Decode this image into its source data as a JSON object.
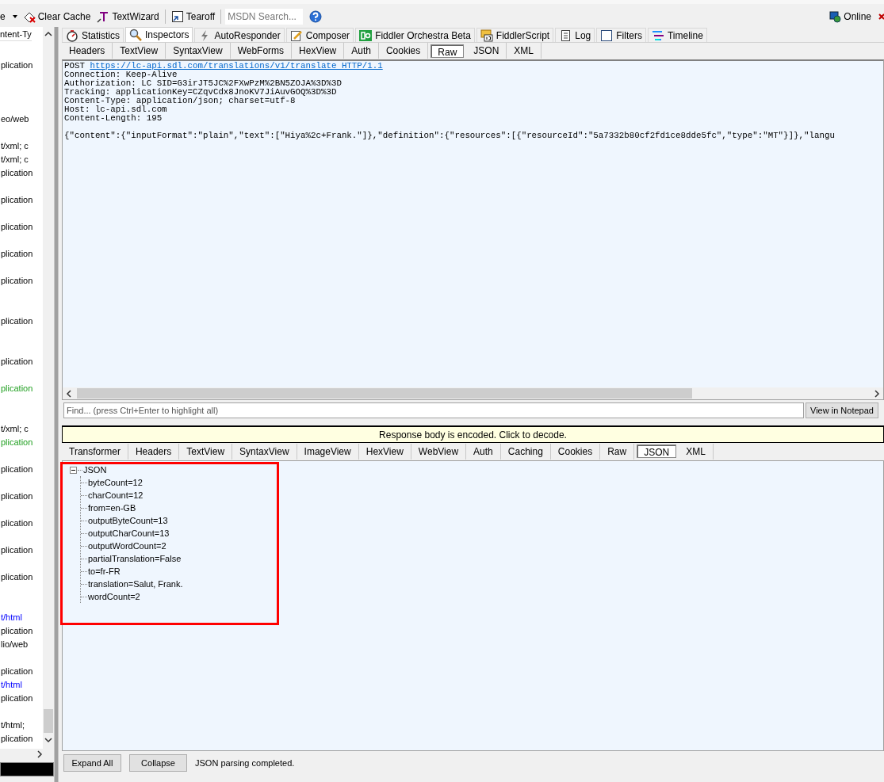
{
  "toolbar": {
    "cut_item": "e",
    "clear_cache": "Clear Cache",
    "text_wizard": "TextWizard",
    "tearoff": "Tearoff",
    "search": {
      "placeholder": "MSDN Search..."
    },
    "online": "Online"
  },
  "sessions": {
    "header": "ntent-Ty",
    "rows": [
      {
        "text": "plication"
      },
      {},
      {},
      {},
      {
        "text": "eo/web"
      },
      {},
      {
        "text": "t/xml; c"
      },
      {
        "text": "t/xml; c"
      },
      {
        "text": "plication"
      },
      {},
      {
        "text": "plication"
      },
      {},
      {
        "text": "plication"
      },
      {},
      {
        "text": "plication"
      },
      {},
      {
        "text": "plication"
      },
      {},
      {},
      {
        "text": "plication"
      },
      {},
      {},
      {
        "text": "plication"
      },
      {},
      {
        "text": "plication",
        "color": "#22a022"
      },
      {},
      {},
      {
        "text": "t/xml; c"
      },
      {
        "text": "plication",
        "color": "#22a022"
      },
      {},
      {
        "text": "plication"
      },
      {},
      {
        "text": "plication"
      },
      {},
      {
        "text": "plication"
      },
      {},
      {
        "text": "plication"
      },
      {},
      {
        "text": "plication"
      },
      {},
      {},
      {
        "text": "t/html",
        "color": "#0000ff"
      },
      {
        "text": "plication"
      },
      {
        "text": "lio/web"
      },
      {},
      {
        "text": "plication"
      },
      {
        "text": "t/html",
        "color": "#0000ff"
      },
      {
        "text": "plication"
      },
      {},
      {
        "text": "t/html;"
      },
      {
        "text": "plication"
      }
    ]
  },
  "tabs": [
    {
      "label": "Statistics",
      "selected": false
    },
    {
      "label": "Inspectors",
      "selected": true
    },
    {
      "label": "AutoResponder",
      "selected": false
    },
    {
      "label": "Composer",
      "selected": false
    },
    {
      "label": "Fiddler Orchestra Beta",
      "selected": false
    },
    {
      "label": "FiddlerScript",
      "selected": false
    },
    {
      "label": "Log",
      "selected": false
    },
    {
      "label": "Filters",
      "selected": false
    },
    {
      "label": "Timeline",
      "selected": false
    }
  ],
  "request": {
    "tabs": [
      {
        "label": "Headers",
        "selected": false
      },
      {
        "label": "TextView",
        "selected": false
      },
      {
        "label": "SyntaxView",
        "selected": false
      },
      {
        "label": "WebForms",
        "selected": false
      },
      {
        "label": "HexView",
        "selected": false
      },
      {
        "label": "Auth",
        "selected": false
      },
      {
        "label": "Cookies",
        "selected": false
      },
      {
        "label": "Raw",
        "selected": true
      },
      {
        "label": "JSON",
        "selected": false
      },
      {
        "label": "XML",
        "selected": false
      }
    ],
    "method": "POST",
    "url": "https://lc-api.sdl.com/translations/v1/translate HTTP/1.1",
    "headers": [
      "Connection: Keep-Alive",
      "Authorization: LC SID=G3irJT5JC%2FXwPzM%2BN5ZOJA%3D%3D",
      "Tracking: applicationKey=CZqvCdx8JnoKV7JiAuvGOQ%3D%3D",
      "Content-Type: application/json; charset=utf-8",
      "Host: lc-api.sdl.com",
      "Content-Length: 195"
    ],
    "body": "{\"content\":{\"inputFormat\":\"plain\",\"text\":[\"Hiya%2c+Frank.\"]},\"definition\":{\"resources\":[{\"resourceId\":\"5a7332b80cf2fd1ce8dde5fc\",\"type\":\"MT\"}]},\"langu",
    "find": {
      "placeholder": "Find... (press Ctrl+Enter to highlight all)"
    },
    "view_in_notepad": "View in Notepad"
  },
  "response": {
    "banner": "Response body is encoded. Click to decode.",
    "tabs": [
      {
        "label": "Transformer",
        "selected": false
      },
      {
        "label": "Headers",
        "selected": false
      },
      {
        "label": "TextView",
        "selected": false
      },
      {
        "label": "SyntaxView",
        "selected": false
      },
      {
        "label": "ImageView",
        "selected": false
      },
      {
        "label": "HexView",
        "selected": false
      },
      {
        "label": "WebView",
        "selected": false
      },
      {
        "label": "Auth",
        "selected": false
      },
      {
        "label": "Caching",
        "selected": false
      },
      {
        "label": "Cookies",
        "selected": false
      },
      {
        "label": "Raw",
        "selected": false
      },
      {
        "label": "JSON",
        "selected": true
      },
      {
        "label": "XML",
        "selected": false
      }
    ],
    "tree": {
      "label": "JSON",
      "expanded": true,
      "children": [
        {
          "label": "byteCount=12"
        },
        {
          "label": "charCount=12"
        },
        {
          "label": "from=en-GB"
        },
        {
          "label": "outputByteCount=13"
        },
        {
          "label": "outputCharCount=13"
        },
        {
          "label": "outputWordCount=2"
        },
        {
          "label": "partialTranslation=False"
        },
        {
          "label": "to=fr-FR"
        },
        {
          "label": "translation=Salut, Frank."
        },
        {
          "label": "wordCount=2"
        }
      ]
    },
    "buttons": [
      "Expand All",
      "Collapse"
    ],
    "status": "JSON parsing completed."
  }
}
